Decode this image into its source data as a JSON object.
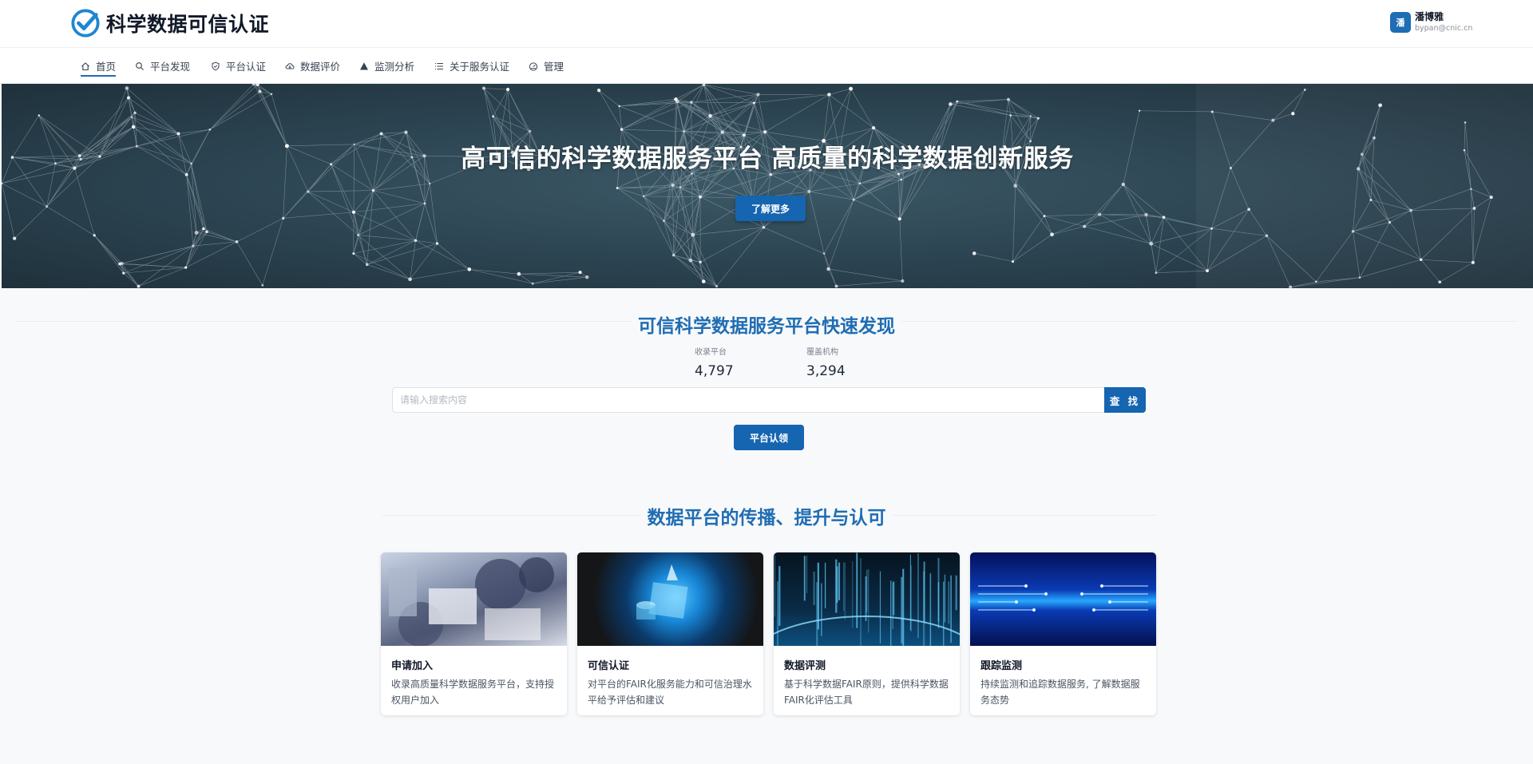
{
  "header": {
    "brand": "科学数据可信认证",
    "user": {
      "avatar_char": "潘",
      "name": "潘博雅",
      "email": "bypan@cnic.cn"
    }
  },
  "nav": {
    "items": [
      {
        "label": "首页",
        "icon": "home-icon"
      },
      {
        "label": "平台发现",
        "icon": "search-icon"
      },
      {
        "label": "平台认证",
        "icon": "shield-check-icon"
      },
      {
        "label": "数据评价",
        "icon": "cloud-icon"
      },
      {
        "label": "监测分析",
        "icon": "warning-icon"
      },
      {
        "label": "关于服务认证",
        "icon": "list-icon"
      },
      {
        "label": "管理",
        "icon": "dashboard-icon"
      }
    ],
    "active_index": 0
  },
  "hero": {
    "title": "高可信的科学数据服务平台  高质量的科学数据创新服务",
    "button": "了解更多"
  },
  "discover": {
    "title": "可信科学数据服务平台快速发现",
    "stats": [
      {
        "label": "收录平台",
        "value": "4,797"
      },
      {
        "label": "覆盖机构",
        "value": "3,294"
      }
    ],
    "search_placeholder": "请输入搜索内容",
    "search_button": "查 找",
    "claim_button": "平台认领"
  },
  "features": {
    "title": "数据平台的传播、提升与认可",
    "cards": [
      {
        "title": "申请加入",
        "desc": "收录高质量科学数据服务平台，支持授权用户加入"
      },
      {
        "title": "可信认证",
        "desc": "对平台的FAIR化服务能力和可信治理水平给予评估和建议"
      },
      {
        "title": "数据评测",
        "desc": "基于科学数据FAIR原则，提供科学数据FAIR化评估工具"
      },
      {
        "title": "跟踪监测",
        "desc": "持续监测和追踪数据服务, 了解数据服务态势"
      }
    ]
  },
  "colors": {
    "accent": "#1f6db3",
    "button": "#1565b0"
  }
}
